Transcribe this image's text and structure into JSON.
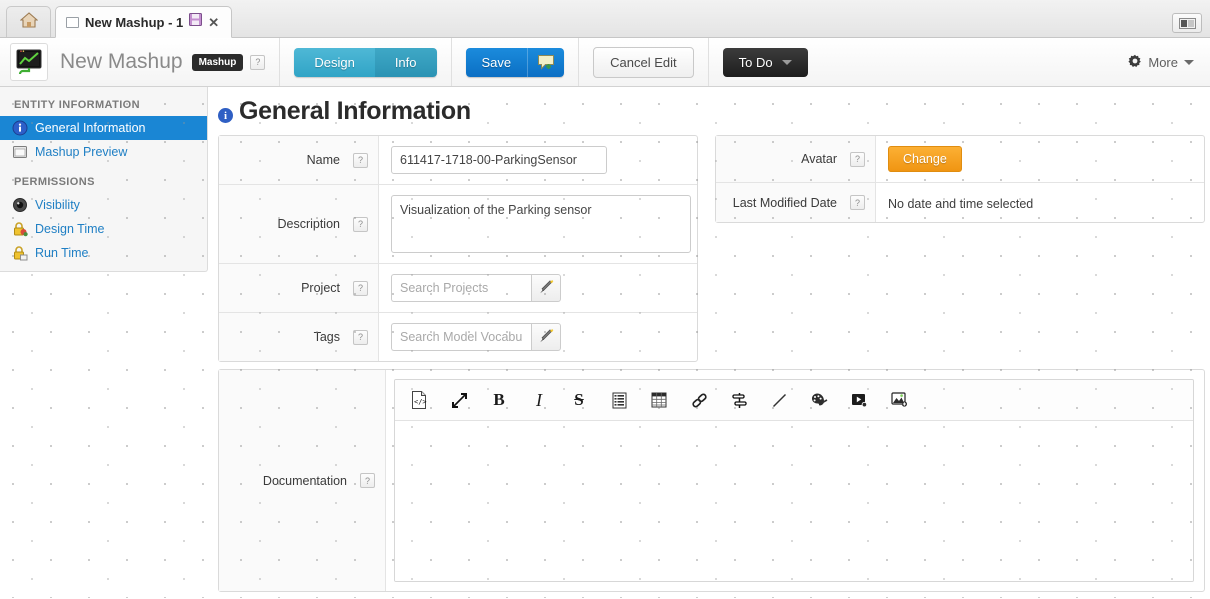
{
  "window": {
    "home_tab_icon": "home-icon",
    "tab": {
      "title": "New Mashup - 1",
      "save_icon": "floppy-disk-icon",
      "close_icon": "close-icon",
      "checkbox_icon": "document-icon"
    },
    "screenshot_button_icon": "screenshot-icon"
  },
  "appbar": {
    "logo_icon": "mashup-monitor-icon",
    "title": "New Mashup",
    "type_badge": "Mashup",
    "help_icon": "?",
    "tabs": [
      {
        "label": "Design",
        "selected": false
      },
      {
        "label": "Info",
        "selected": true
      }
    ],
    "save": {
      "label": "Save",
      "icon": "comment-add-icon"
    },
    "cancel": {
      "label": "Cancel Edit"
    },
    "todo": {
      "label": "To Do",
      "icon": "chevron-down-icon"
    },
    "more": {
      "label": "More",
      "icon": "gear-icon",
      "caret": "chevron-down-icon"
    },
    "colors": {
      "tab_active": "#2b93b4",
      "tab_inactive": "#30a4c6",
      "save_blue": "#0b6fc4",
      "todo_dark": "#1d1d1d",
      "orange": "#f09512"
    }
  },
  "sidebar": {
    "sections": [
      {
        "heading": "ENTITY INFORMATION",
        "items": [
          {
            "label": "General Information",
            "icon": "info-circle-icon",
            "active": true
          },
          {
            "label": "Mashup Preview",
            "icon": "preview-window-icon",
            "active": false
          }
        ]
      },
      {
        "heading": "PERMISSIONS",
        "items": [
          {
            "label": "Visibility",
            "icon": "eye-icon",
            "active": false
          },
          {
            "label": "Design Time",
            "icon": "lock-user-icon",
            "active": false
          },
          {
            "label": "Run Time",
            "icon": "lock-run-icon",
            "active": false
          }
        ]
      }
    ]
  },
  "page": {
    "title": "General Information",
    "title_icon": "info-circle-icon"
  },
  "form_left": {
    "name": {
      "label": "Name",
      "help": "?",
      "value": "611417-1718-00-ParkingSensor",
      "placeholder": ""
    },
    "description": {
      "label": "Description",
      "help": "?",
      "value": "Visualization of the Parking sensor",
      "placeholder": ""
    },
    "project": {
      "label": "Project",
      "help": "?",
      "value": "",
      "placeholder": "Search Projects",
      "wand_icon": "magic-wand-icon"
    },
    "tags": {
      "label": "Tags",
      "help": "?",
      "value": "",
      "placeholder": "Search Model Vocabulary",
      "wand_icon": "magic-wand-icon"
    }
  },
  "form_right": {
    "avatar": {
      "label": "Avatar",
      "help": "?",
      "button_label": "Change"
    },
    "last_modified": {
      "label": "Last Modified Date",
      "help": "?",
      "value": "No date and time selected"
    }
  },
  "documentation": {
    "label": "Documentation",
    "help": "?",
    "content": "",
    "toolbar": [
      {
        "name": "source-code-icon",
        "glyph": ""
      },
      {
        "name": "fullscreen-icon",
        "glyph": ""
      },
      {
        "name": "bold-icon",
        "glyph": "B"
      },
      {
        "name": "italic-icon",
        "glyph": "I"
      },
      {
        "name": "strikethrough-icon",
        "glyph": "S"
      },
      {
        "name": "bullet-list-icon",
        "glyph": ""
      },
      {
        "name": "table-icon",
        "glyph": ""
      },
      {
        "name": "link-icon",
        "glyph": ""
      },
      {
        "name": "anchor-icon",
        "glyph": ""
      },
      {
        "name": "horizontal-rule-icon",
        "glyph": ""
      },
      {
        "name": "color-palette-icon",
        "glyph": ""
      },
      {
        "name": "video-icon",
        "glyph": ""
      },
      {
        "name": "image-icon",
        "glyph": ""
      }
    ]
  }
}
